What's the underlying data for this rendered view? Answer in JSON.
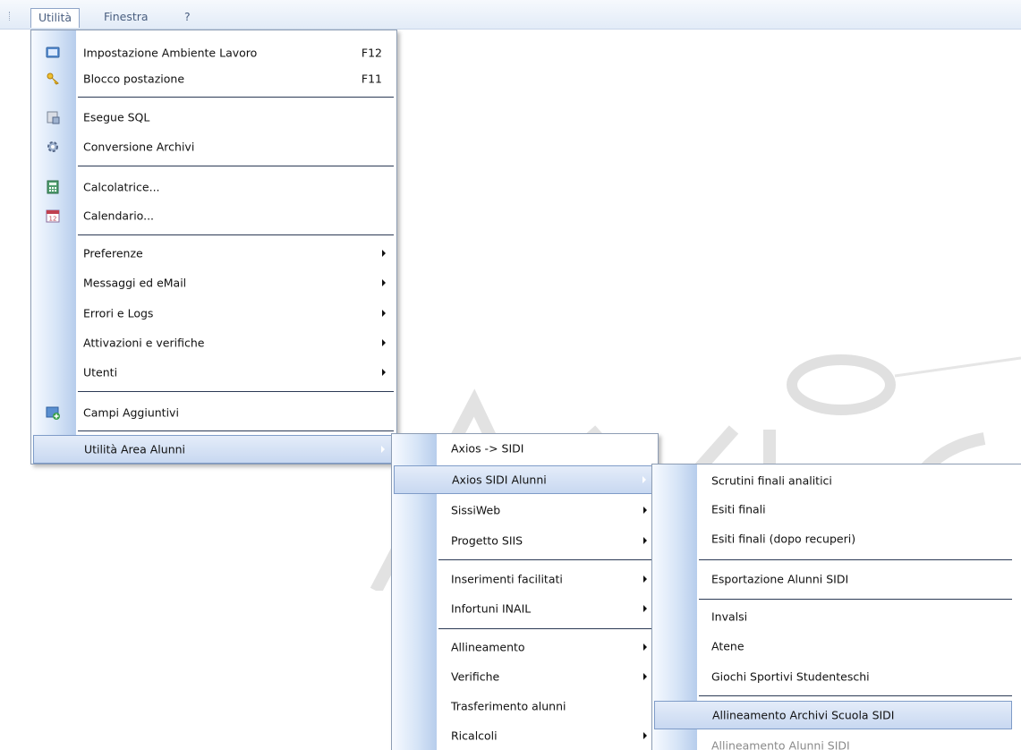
{
  "menubar": {
    "items": [
      {
        "label": "Utilità"
      },
      {
        "label": "Finestra"
      },
      {
        "label": "?"
      }
    ]
  },
  "menu_utilita": {
    "items": [
      {
        "label": "Impostazione Ambiente Lavoro",
        "shortcut": "F12",
        "icon": "monitor-settings-icon"
      },
      {
        "label": "Blocco postazione",
        "shortcut": "F11",
        "icon": "keys-icon"
      },
      {
        "label": "Esegue SQL",
        "icon": "sql-icon"
      },
      {
        "label": "Conversione Archivi",
        "icon": "convert-gear-icon"
      },
      {
        "label": "Calcolatrice...",
        "icon": "calculator-icon"
      },
      {
        "label": "Calendario...",
        "icon": "calendar-icon",
        "icon_text": "12"
      },
      {
        "label": "Preferenze",
        "submenu": true
      },
      {
        "label": "Messaggi ed eMail",
        "submenu": true
      },
      {
        "label": "Errori e Logs",
        "submenu": true
      },
      {
        "label": "Attivazioni e verifiche",
        "submenu": true
      },
      {
        "label": "Utenti",
        "submenu": true
      },
      {
        "label": "Campi Aggiuntivi",
        "icon": "add-field-icon"
      },
      {
        "label": "Utilità Area Alunni",
        "submenu": true,
        "highlighted": true
      }
    ]
  },
  "menu_area_alunni": {
    "items": [
      {
        "label": "Axios -> SIDI"
      },
      {
        "label": "Axios SIDI Alunni",
        "submenu": true,
        "highlighted": true
      },
      {
        "label": "SissiWeb",
        "submenu": true
      },
      {
        "label": "Progetto SIIS",
        "submenu": true
      },
      {
        "label": "Inserimenti facilitati",
        "submenu": true
      },
      {
        "label": "Infortuni INAIL",
        "submenu": true
      },
      {
        "label": "Allineamento",
        "submenu": true
      },
      {
        "label": "Verifiche",
        "submenu": true
      },
      {
        "label": "Trasferimento alunni"
      },
      {
        "label": "Ricalcoli",
        "submenu": true
      }
    ]
  },
  "menu_sidi_alunni": {
    "items": [
      {
        "label": "Scrutini finali analitici"
      },
      {
        "label": "Esiti finali"
      },
      {
        "label": "Esiti finali (dopo recuperi)"
      },
      {
        "label": "Esportazione Alunni SIDI"
      },
      {
        "label": "Invalsi"
      },
      {
        "label": "Atene"
      },
      {
        "label": "Giochi Sportivi Studenteschi"
      },
      {
        "label": "Allineamento Archivi Scuola SIDI",
        "highlighted": true
      },
      {
        "label": "Allineamento Alunni SIDI",
        "disabled": true
      }
    ]
  },
  "colors": {
    "highlight_border": "#7f9cc8",
    "menu_border": "#8d9db4",
    "menubar_text": "#4a5f80"
  }
}
